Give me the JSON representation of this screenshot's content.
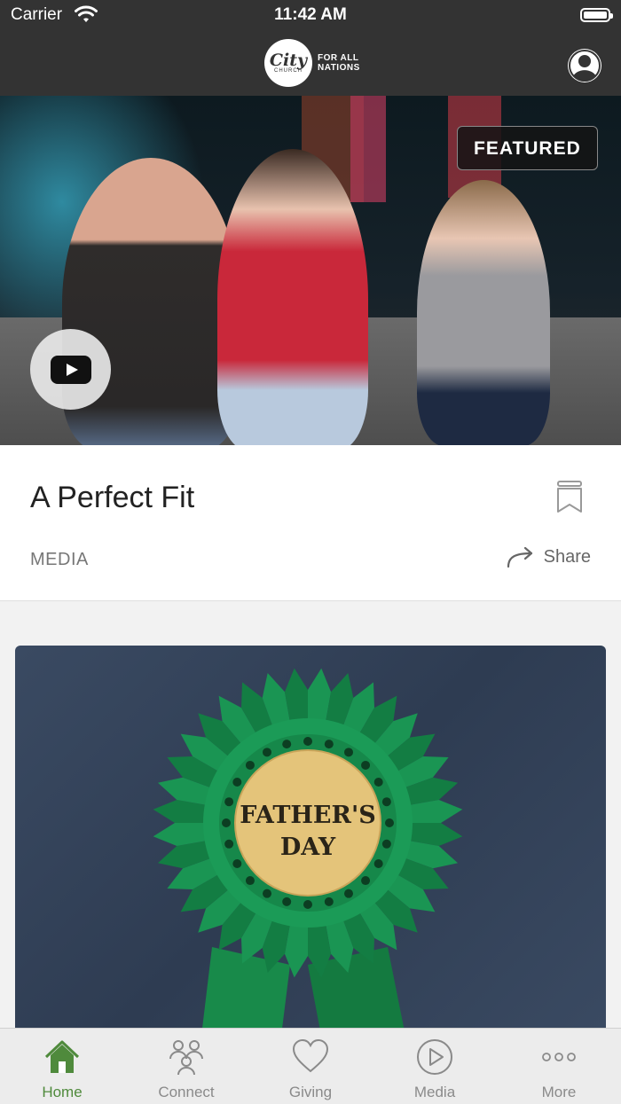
{
  "status_bar": {
    "carrier": "Carrier",
    "time": "11:42 AM"
  },
  "header": {
    "logo": {
      "wordmark": "City",
      "sub": "CHURCH",
      "tagline_line1": "FOR ALL",
      "tagline_line2": "NATIONS"
    },
    "profile_icon": "person-circle-icon"
  },
  "featured_card": {
    "badge": "FEATURED",
    "title": "A Perfect Fit",
    "category": "MEDIA",
    "share_label": "Share",
    "play_icon": "youtube-play-icon",
    "bookmark_icon": "bookmark-icon"
  },
  "second_card": {
    "image_text_line1": "FATHER'S",
    "image_text_line2": "DAY"
  },
  "tab_bar": {
    "active_color": "#4f8a3c",
    "items": [
      {
        "label": "Home",
        "icon": "home-icon",
        "active": true
      },
      {
        "label": "Connect",
        "icon": "people-icon",
        "active": false
      },
      {
        "label": "Giving",
        "icon": "heart-icon",
        "active": false
      },
      {
        "label": "Media",
        "icon": "play-circle-icon",
        "active": false
      },
      {
        "label": "More",
        "icon": "more-dots-icon",
        "active": false
      }
    ]
  }
}
